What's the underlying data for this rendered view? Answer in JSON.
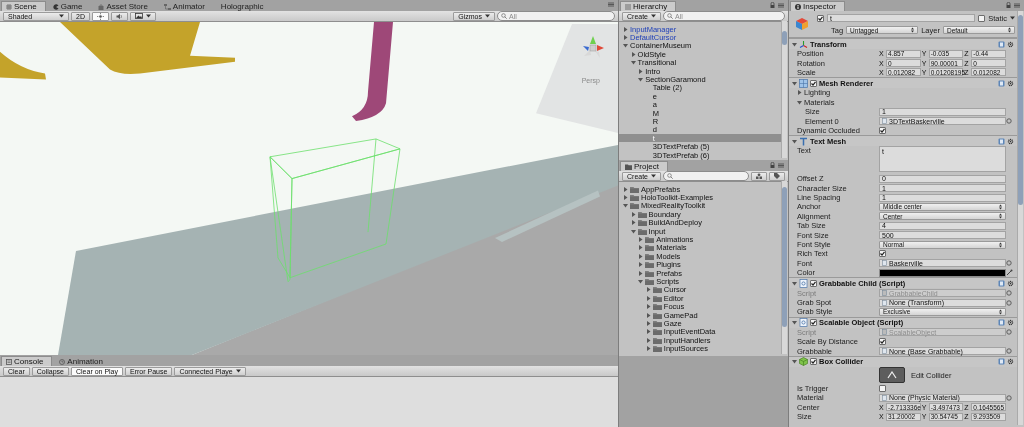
{
  "scene_tabs": [
    {
      "label": "Scene",
      "selected": true
    },
    {
      "label": "Game",
      "selected": false
    },
    {
      "label": "Asset Store",
      "selected": false
    },
    {
      "label": "Animator",
      "selected": false
    },
    {
      "label": "Holographic",
      "selected": false
    }
  ],
  "scene_toolbar": {
    "shading": "Shaded",
    "mode_2d": "2D",
    "lighting_on": true,
    "audio_on": false,
    "gizmos": "Gizmos",
    "search_placeholder": "All"
  },
  "scene_view": {
    "gizmo_label": "Persp"
  },
  "console_tabs": [
    {
      "label": "Console",
      "selected": true
    },
    {
      "label": "Animation",
      "selected": false
    }
  ],
  "console_toolbar": [
    {
      "label": "Clear",
      "kind": "button",
      "selected": false
    },
    {
      "label": "Collapse",
      "kind": "toggle",
      "selected": false
    },
    {
      "label": "Clear on Play",
      "kind": "toggle",
      "selected": true
    },
    {
      "label": "Error Pause",
      "kind": "toggle",
      "selected": false
    },
    {
      "label": "Connected Playe",
      "kind": "dropdown",
      "selected": false
    }
  ],
  "hierarchy": {
    "title": "Hierarchy",
    "create": "Create",
    "search_placeholder": "All",
    "items": [
      {
        "label": "InputManager",
        "kind": "prefab",
        "expanded": false,
        "selected": false
      },
      {
        "label": "DefaultCursor",
        "kind": "prefab",
        "expanded": false,
        "selected": false
      },
      {
        "label": "ContainerMuseum",
        "kind": "object",
        "expanded": true,
        "selected": false,
        "children": [
          {
            "label": "OldStyle",
            "kind": "object",
            "expanded": false,
            "selected": false
          },
          {
            "label": "Transitional",
            "kind": "object",
            "expanded": true,
            "selected": false,
            "children": [
              {
                "label": "Intro",
                "kind": "object",
                "expanded": false,
                "selected": false
              },
              {
                "label": "SectionGaramond",
                "kind": "object",
                "expanded": true,
                "selected": false,
                "children": [
                  {
                    "label": "Table (2)",
                    "kind": "object",
                    "selected": false
                  },
                  {
                    "label": "e",
                    "kind": "object",
                    "selected": false
                  },
                  {
                    "label": "a",
                    "kind": "object",
                    "selected": false
                  },
                  {
                    "label": "M",
                    "kind": "object",
                    "selected": false
                  },
                  {
                    "label": "R",
                    "kind": "object",
                    "selected": false
                  },
                  {
                    "label": "d",
                    "kind": "object",
                    "selected": false
                  },
                  {
                    "label": "t",
                    "kind": "object",
                    "selected": true
                  },
                  {
                    "label": "3DTextPrefab (5)",
                    "kind": "object",
                    "selected": false
                  },
                  {
                    "label": "3DTextPrefab (6)",
                    "kind": "object",
                    "selected": false
                  }
                ]
              }
            ]
          }
        ]
      }
    ]
  },
  "project": {
    "title": "Project",
    "create": "Create",
    "items": [
      {
        "label": "AppPrefabs",
        "kind": "folder",
        "expanded": false,
        "selected": false
      },
      {
        "label": "HoloToolkit-Examples",
        "kind": "folder",
        "expanded": false,
        "selected": false
      },
      {
        "label": "MixedRealityToolkit",
        "kind": "folder",
        "expanded": true,
        "selected": false,
        "children": [
          {
            "label": "Boundary",
            "kind": "folder",
            "expanded": false,
            "selected": false
          },
          {
            "label": "BuildAndDeploy",
            "kind": "folder",
            "expanded": false,
            "selected": false
          },
          {
            "label": "Input",
            "kind": "folder",
            "expanded": true,
            "selected": false,
            "children": [
              {
                "label": "Animations",
                "kind": "folder",
                "expanded": false,
                "selected": false
              },
              {
                "label": "Materials",
                "kind": "folder",
                "expanded": false,
                "selected": false
              },
              {
                "label": "Models",
                "kind": "folder",
                "expanded": false,
                "selected": false
              },
              {
                "label": "Plugins",
                "kind": "folder",
                "expanded": false,
                "selected": false
              },
              {
                "label": "Prefabs",
                "kind": "folder",
                "expanded": false,
                "selected": false
              },
              {
                "label": "Scripts",
                "kind": "folder",
                "expanded": true,
                "selected": false,
                "children": [
                  {
                    "label": "Cursor",
                    "kind": "folder",
                    "expanded": false,
                    "selected": false
                  },
                  {
                    "label": "Editor",
                    "kind": "folder",
                    "expanded": false,
                    "selected": false
                  },
                  {
                    "label": "Focus",
                    "kind": "folder",
                    "expanded": false,
                    "selected": false
                  },
                  {
                    "label": "GamePad",
                    "kind": "folder",
                    "expanded": false,
                    "selected": false
                  },
                  {
                    "label": "Gaze",
                    "kind": "folder",
                    "expanded": false,
                    "selected": false
                  },
                  {
                    "label": "InputEventData",
                    "kind": "folder",
                    "expanded": false,
                    "selected": false
                  },
                  {
                    "label": "InputHandlers",
                    "kind": "folder",
                    "expanded": false,
                    "selected": false
                  },
                  {
                    "label": "InputSources",
                    "kind": "folder",
                    "expanded": false,
                    "selected": false
                  }
                ]
              }
            ]
          }
        ]
      }
    ]
  },
  "inspector": {
    "title": "Inspector",
    "object": {
      "active": true,
      "name": "t",
      "static_label": "Static",
      "static": false,
      "tag_label": "Tag",
      "tag": "Untagged",
      "layer_label": "Layer",
      "layer": "Default"
    },
    "components": [
      {
        "kind": "transform",
        "title": "Transform",
        "expanded": true,
        "properties": [
          {
            "kind": "vector",
            "label": "Position",
            "values": [
              {
                "axis": "X",
                "value": "4.857"
              },
              {
                "axis": "Y",
                "value": "-0.035"
              },
              {
                "axis": "Z",
                "value": "-0.44"
              }
            ]
          },
          {
            "kind": "vector",
            "label": "Rotation",
            "values": [
              {
                "axis": "X",
                "value": "0"
              },
              {
                "axis": "Y",
                "value": "90.00001"
              },
              {
                "axis": "Z",
                "value": "0"
              }
            ]
          },
          {
            "kind": "vector",
            "label": "Scale",
            "values": [
              {
                "axis": "X",
                "value": "0.012082"
              },
              {
                "axis": "Y",
                "value": "0.01208195"
              },
              {
                "axis": "Z",
                "value": "0.012082"
              }
            ]
          }
        ]
      },
      {
        "kind": "mesh_renderer",
        "title": "Mesh Renderer",
        "expanded": true,
        "enabled": true,
        "properties": [
          {
            "kind": "foldout",
            "label": "Lighting",
            "expanded": false
          },
          {
            "kind": "foldout",
            "label": "Materials",
            "expanded": true,
            "children": [
              {
                "kind": "text",
                "label": "Size",
                "value": "1"
              },
              {
                "kind": "object",
                "label": "Element 0",
                "value": "3DTextBaskerville",
                "disabled": false
              }
            ]
          },
          {
            "kind": "checkbox",
            "label": "Dynamic Occluded",
            "checked": true
          }
        ]
      },
      {
        "kind": "text_mesh",
        "title": "Text Mesh",
        "expanded": true,
        "properties": [
          {
            "kind": "textarea",
            "label": "Text",
            "value": "t"
          },
          {
            "kind": "text",
            "label": "Offset Z",
            "value": "0"
          },
          {
            "kind": "text",
            "label": "Character Size",
            "value": "1"
          },
          {
            "kind": "text",
            "label": "Line Spacing",
            "value": "1"
          },
          {
            "kind": "dropdown",
            "label": "Anchor",
            "value": "Middle center"
          },
          {
            "kind": "dropdown",
            "label": "Alignment",
            "value": "Center"
          },
          {
            "kind": "text",
            "label": "Tab Size",
            "value": "4"
          },
          {
            "kind": "text",
            "label": "Font Size",
            "value": "500"
          },
          {
            "kind": "dropdown",
            "label": "Font Style",
            "value": "Normal"
          },
          {
            "kind": "checkbox",
            "label": "Rich Text",
            "checked": true
          },
          {
            "kind": "object",
            "label": "Font",
            "value": "Baskerville",
            "disabled": false
          },
          {
            "kind": "color",
            "label": "Color",
            "color": "#000000"
          }
        ]
      },
      {
        "kind": "script",
        "title": "Grabbable Child (Script)",
        "expanded": true,
        "enabled": true,
        "properties": [
          {
            "kind": "object",
            "label": "Script",
            "value": "GrabbableChild",
            "disabled": true
          },
          {
            "kind": "object",
            "label": "Grab Spot",
            "value": "None (Transform)",
            "disabled": false
          },
          {
            "kind": "dropdown",
            "label": "Grab Style",
            "value": "Exclusive"
          }
        ]
      },
      {
        "kind": "script",
        "title": "Scalable Object (Script)",
        "expanded": true,
        "enabled": true,
        "properties": [
          {
            "kind": "object",
            "label": "Script",
            "value": "ScalableObject",
            "disabled": true
          },
          {
            "kind": "checkbox",
            "label": "Scale By Distance",
            "checked": true
          },
          {
            "kind": "object",
            "label": "Grabbable",
            "value": "None (Base Grabbable)",
            "disabled": false
          }
        ]
      },
      {
        "kind": "collider",
        "title": "Box Collider",
        "expanded": true,
        "enabled": true,
        "properties": [
          {
            "kind": "edit_button",
            "label": "Edit Collider"
          },
          {
            "kind": "checkbox",
            "label": "Is Trigger",
            "checked": false
          },
          {
            "kind": "object",
            "label": "Material",
            "value": "None (Physic Material)",
            "disabled": false
          },
          {
            "kind": "vector",
            "label": "Center",
            "values": [
              {
                "axis": "X",
                "value": "-2.713336e"
              },
              {
                "axis": "Y",
                "value": "-3.497473"
              },
              {
                "axis": "Z",
                "value": "0.1645565"
              }
            ]
          },
          {
            "kind": "vector",
            "label": "Size",
            "values": [
              {
                "axis": "X",
                "value": "31.20002"
              },
              {
                "axis": "Y",
                "value": "30.54745"
              },
              {
                "axis": "Z",
                "value": "9.293509"
              }
            ]
          }
        ]
      }
    ]
  }
}
